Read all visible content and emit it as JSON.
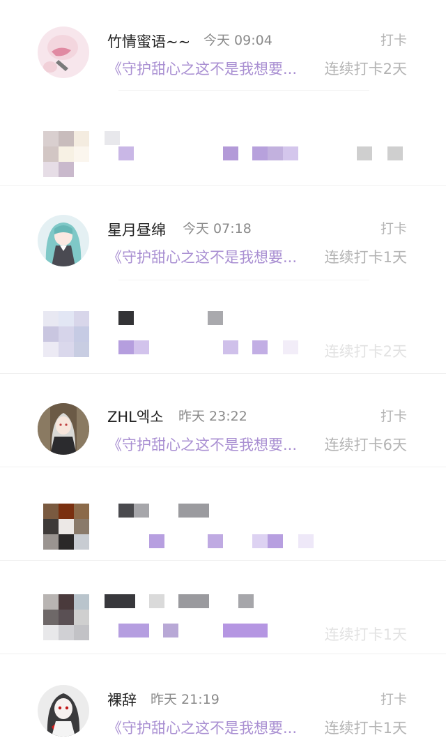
{
  "items": [
    {
      "name": "竹情蜜语~~",
      "time": "今天 09:04",
      "tag": "打卡",
      "preview": "《守护甜心之这不是我想要...",
      "streak": "连续打卡2天"
    },
    {
      "name": "星月昼绵",
      "time": "今天 07:18",
      "tag": "打卡",
      "preview": "《守护甜心之这不是我想要...",
      "streak": "连续打卡1天"
    },
    {
      "name": "ZHL엑소",
      "time": "昨天 23:22",
      "tag": "打卡",
      "preview": "《守护甜心之这不是我想要...",
      "streak": "连续打卡6天"
    },
    {
      "name": "裸辞",
      "time": "昨天 21:19",
      "tag": "打卡",
      "preview": "《守护甜心之这不是我想要...",
      "streak": "连续打卡1天"
    }
  ],
  "blurred_streak_fragments": [
    "连续打卡2天",
    "连续打卡1天"
  ],
  "colors": {
    "accent_purple": "#a98fd2",
    "muted_gray": "#b3b3b3",
    "name": "#222222",
    "time": "#8a8a8a"
  }
}
